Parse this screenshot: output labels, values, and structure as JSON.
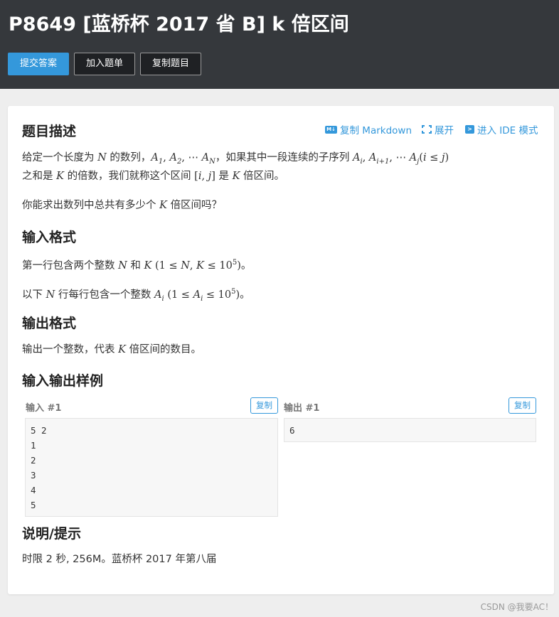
{
  "header": {
    "title": "P8649 [蓝桥杯 2017 省 B] k 倍区间",
    "buttons": {
      "submit": "提交答案",
      "add_to_list": "加入题单",
      "copy_problem": "复制题目"
    }
  },
  "toolbar": {
    "copy_markdown": "复制 Markdown",
    "expand": "展开",
    "enter_ide": "进入 IDE 模式",
    "md_icon_text": "M↓",
    "ide_icon_text": ">"
  },
  "description": {
    "heading": "题目描述",
    "line1_pre": "给定一个长度为",
    "line1_mid1": "的数列，",
    "line1_mid2": "，如果其中一段连续的子序列",
    "line2_a": "之和是",
    "line2_b": "的倍数，我们就称这个区间",
    "line2_c": "是",
    "line2_d": "倍区间。",
    "question_a": "你能求出数列中总共有多少个",
    "question_b": "倍区间吗？"
  },
  "input_format": {
    "heading": "输入格式",
    "line1_a": "第一行包含两个整数",
    "line1_and": "和",
    "line1_end": "。",
    "line2_a": "以下",
    "line2_b": "行每行包含一个整数",
    "line2_end": "。"
  },
  "output_format": {
    "heading": "输出格式",
    "line_a": "输出一个整数，代表",
    "line_b": "倍区间的数目。"
  },
  "samples": {
    "heading": "输入输出样例",
    "input_label": "输入 #1",
    "output_label": "输出 #1",
    "copy_label": "复制",
    "input_lines": [
      "5 2",
      "1",
      "2",
      "3",
      "4",
      "5"
    ],
    "output_lines": [
      "6"
    ]
  },
  "hint": {
    "heading": "说明/提示",
    "text": "时限 2 秒, 256M。蓝桥杯 2017 年第八届"
  },
  "watermark": "CSDN @我要AC！"
}
